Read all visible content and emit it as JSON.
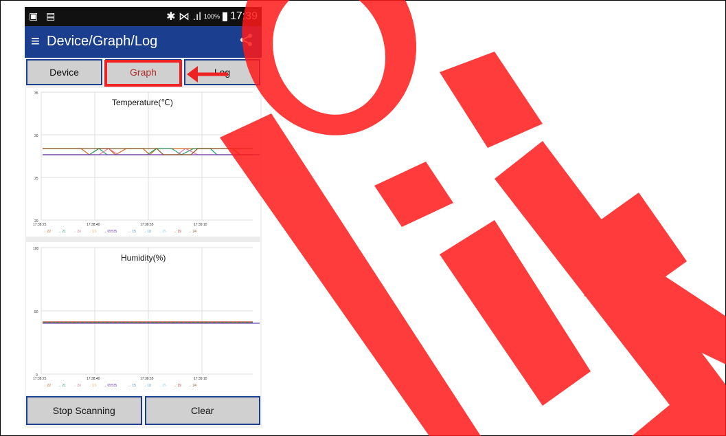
{
  "statusbar": {
    "left_icons": "▣ ▤",
    "bt_signal": "✱ ⋈ .ıl",
    "battery_pct": "100%",
    "time": "17:39"
  },
  "appbar": {
    "menu_icon": "≡",
    "title": "Device/Graph/Log",
    "share_icon": "share-icon"
  },
  "tabs": [
    {
      "label": "Device"
    },
    {
      "label": "Graph"
    },
    {
      "label": "Log"
    }
  ],
  "temperature_chart": {
    "title": "Temperature(℃)",
    "y_ticks": [
      "35",
      "30",
      "25",
      "20"
    ],
    "x_ticks": [
      "17:38:25",
      "17:38:40",
      "17:38:55",
      "17:39:10"
    ],
    "legend": [
      "22",
      "21",
      "20",
      "17",
      "65535",
      "15",
      "18",
      "25",
      "19",
      "24"
    ]
  },
  "humidity_chart": {
    "title": "Humidity(%)",
    "y_ticks": [
      "100",
      "50",
      "0"
    ],
    "x_ticks": [
      "17:38:25",
      "17:38:40",
      "17:38:55",
      "17:39:10"
    ],
    "legend": [
      "22",
      "21",
      "20",
      "17",
      "65535",
      "15",
      "18",
      "25",
      "19",
      "24"
    ]
  },
  "bottom_buttons": {
    "stop_label": "Stop Scanning",
    "clear_label": "Clear"
  },
  "colors": {
    "appbar": "#1b3f8e",
    "highlight": "#ee2222",
    "watermark": "#ff1a1a"
  }
}
